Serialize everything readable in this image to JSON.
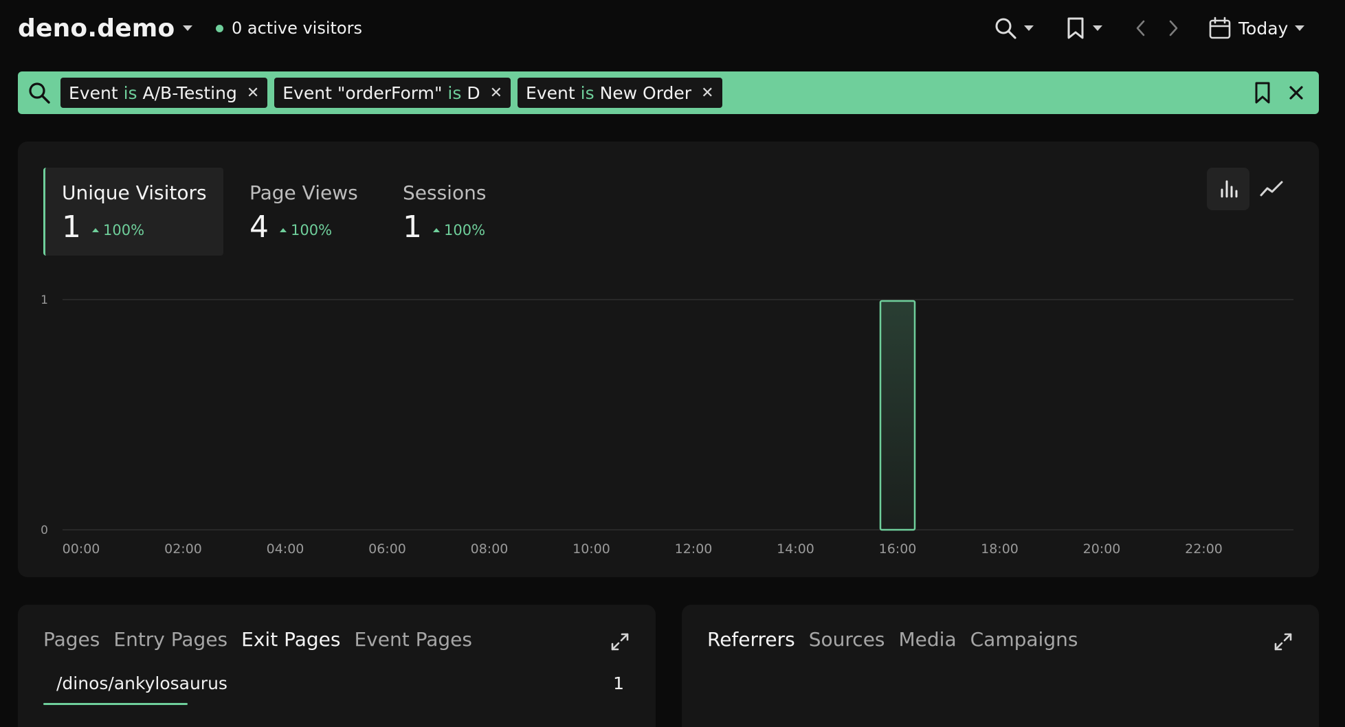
{
  "header": {
    "site_name": "deno.demo",
    "active_visitors": "0 active visitors",
    "date_range": "Today"
  },
  "icons": {
    "search": "search-icon",
    "bookmark": "bookmark-icon",
    "prev": "chevron-left-icon",
    "next": "chevron-right-icon",
    "calendar": "calendar-icon",
    "close": "close-icon",
    "bar_chart": "bar-chart-icon",
    "line_chart": "line-chart-icon",
    "expand": "expand-icon"
  },
  "filters": [
    {
      "field": "Event",
      "op": "is",
      "value": "A/B-Testing"
    },
    {
      "field": "Event \"orderForm\"",
      "op": "is",
      "value": "D"
    },
    {
      "field": "Event",
      "op": "is",
      "value": "New Order"
    }
  ],
  "metrics": [
    {
      "label": "Unique Visitors",
      "value": "1",
      "change": "100%",
      "active": true
    },
    {
      "label": "Page Views",
      "value": "4",
      "change": "100%",
      "active": false
    },
    {
      "label": "Sessions",
      "value": "1",
      "change": "100%",
      "active": false
    }
  ],
  "chart_data": {
    "type": "bar",
    "categories": [
      "00:00",
      "01:00",
      "02:00",
      "03:00",
      "04:00",
      "05:00",
      "06:00",
      "07:00",
      "08:00",
      "09:00",
      "10:00",
      "11:00",
      "12:00",
      "13:00",
      "14:00",
      "15:00",
      "16:00",
      "17:00",
      "18:00",
      "19:00",
      "20:00",
      "21:00",
      "22:00",
      "23:00"
    ],
    "x_tick_labels": [
      "00:00",
      "02:00",
      "04:00",
      "06:00",
      "08:00",
      "10:00",
      "12:00",
      "14:00",
      "16:00",
      "18:00",
      "20:00",
      "22:00"
    ],
    "values": [
      0,
      0,
      0,
      0,
      0,
      0,
      0,
      0,
      0,
      0,
      0,
      0,
      0,
      0,
      0,
      0,
      1,
      0,
      0,
      0,
      0,
      0,
      0,
      0
    ],
    "y_ticks": [
      "0",
      "1"
    ],
    "ylim": [
      0,
      1
    ],
    "grid": true,
    "bar_color": "#6fcf9b"
  },
  "pages_card": {
    "tabs": [
      "Pages",
      "Entry Pages",
      "Exit Pages",
      "Event Pages"
    ],
    "active_tab": "Exit Pages",
    "rows": [
      {
        "path": "/dinos/ankylosaurus",
        "count": "1"
      }
    ]
  },
  "sources_card": {
    "tabs": [
      "Referrers",
      "Sources",
      "Media",
      "Campaigns"
    ],
    "active_tab": "Referrers"
  },
  "colors": {
    "accent": "#6fcf9b",
    "background": "#0b0b0b",
    "card": "#161616"
  }
}
